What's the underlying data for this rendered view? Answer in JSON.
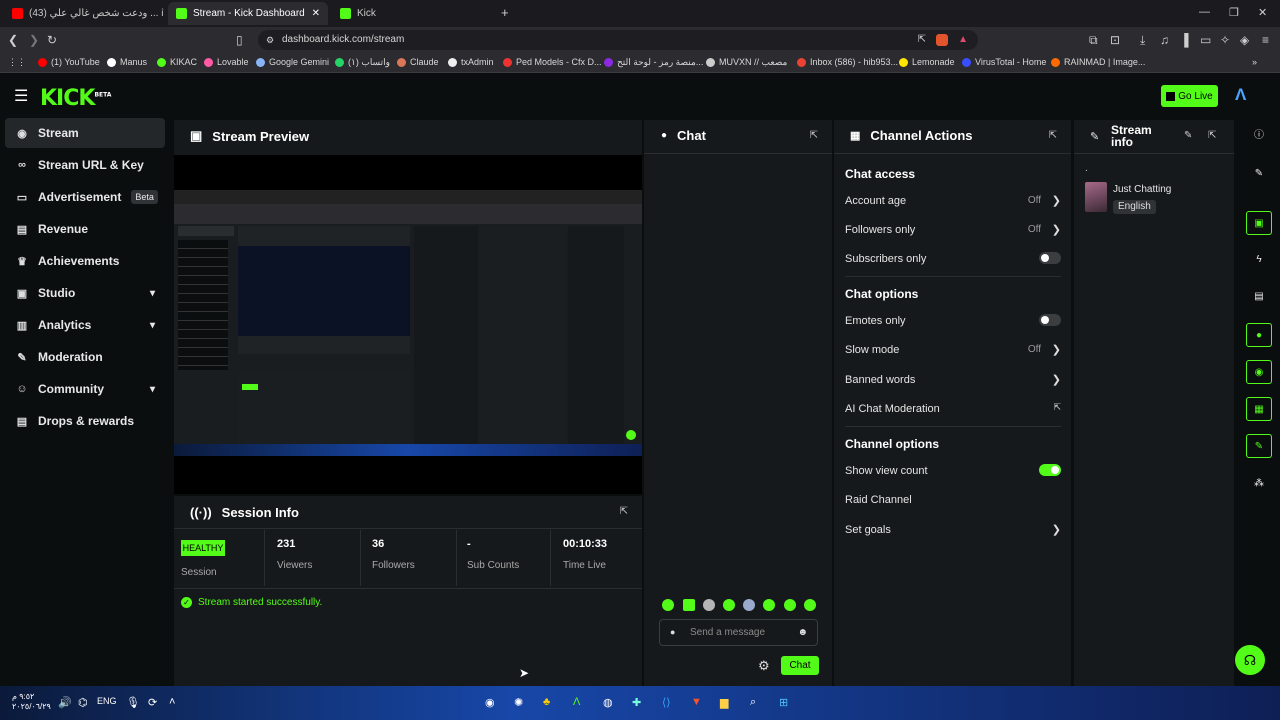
{
  "browser": {
    "tabs": [
      {
        "label": "(43) ودعت شخص غالي علي ... iTube",
        "active": false
      },
      {
        "label": "Stream - Kick Dashboard",
        "active": true
      },
      {
        "label": "Kick",
        "active": false
      }
    ],
    "url": "dashboard.kick.com/stream",
    "bookmarks": [
      "(1) YouTube",
      "Manus",
      "KIKAC",
      "Lovable",
      "Google Gemini",
      "واتساب (١)",
      "Claude",
      "txAdmin",
      "Ped Models - Cfx D...",
      "منصة رمز - لوحة التح...",
      "MUVXN // مصعب",
      "Inbox (586) - hib953...",
      "Lemonade",
      "VirusTotal - Home",
      "RAINMAD | Image..."
    ]
  },
  "header": {
    "logo": "KICK",
    "logo_sup": "BETA",
    "go_live": "Go Live"
  },
  "sidebar": {
    "items": [
      {
        "label": "Stream",
        "icon": "stream-icon",
        "glyph": "((·))"
      },
      {
        "label": "Stream URL & Key",
        "icon": "link-icon",
        "glyph": "🔗"
      },
      {
        "label": "Advertisement",
        "icon": "ad-icon",
        "glyph": "▭",
        "badge": "Beta"
      },
      {
        "label": "Revenue",
        "icon": "chart-icon",
        "glyph": "▤"
      },
      {
        "label": "Achievements",
        "icon": "trophy-icon",
        "glyph": "🏆"
      },
      {
        "label": "Studio",
        "icon": "studio-icon",
        "glyph": "▣"
      },
      {
        "label": "Analytics",
        "icon": "analytics-icon",
        "glyph": "▥"
      },
      {
        "label": "Moderation",
        "icon": "wrench-icon",
        "glyph": "🔧"
      },
      {
        "label": "Community",
        "icon": "community-icon",
        "glyph": "☺"
      },
      {
        "label": "Drops & rewards",
        "icon": "gift-icon",
        "glyph": "▤"
      }
    ]
  },
  "preview": {
    "title": "Stream Preview"
  },
  "session": {
    "title": "Session Info",
    "status_badge": "HEALTHY",
    "status_label": "Session",
    "stats": [
      {
        "value": "231",
        "label": "Viewers"
      },
      {
        "value": "36",
        "label": "Followers"
      },
      {
        "value": "-",
        "label": "Sub Counts"
      },
      {
        "value": "00:10:33",
        "label": "Time Live"
      }
    ],
    "message": "Stream started successfully."
  },
  "chat": {
    "title": "Chat",
    "placeholder": "Send a message",
    "send_label": "Chat"
  },
  "channel_actions": {
    "title": "Channel Actions",
    "sections": {
      "chat_access": "Chat access",
      "chat_options": "Chat options",
      "channel_options": "Channel options"
    },
    "rows": {
      "account_age": {
        "label": "Account age",
        "value": "Off"
      },
      "followers_only": {
        "label": "Followers only",
        "value": "Off"
      },
      "subscribers_only": {
        "label": "Subscribers only",
        "on": false
      },
      "emotes_only": {
        "label": "Emotes only",
        "on": false
      },
      "slow_mode": {
        "label": "Slow mode",
        "value": "Off"
      },
      "banned_words": {
        "label": "Banned words"
      },
      "ai_moderation": {
        "label": "AI Chat Moderation"
      },
      "show_view_count": {
        "label": "Show view count",
        "on": true
      },
      "raid_channel": {
        "label": "Raid Channel"
      },
      "set_goals": {
        "label": "Set goals"
      }
    }
  },
  "stream_info": {
    "title": "Stream info",
    "dot": ".",
    "category": "Just Chatting",
    "language": "English"
  },
  "taskbar": {
    "time": "٩:٥٢ م",
    "date": "٢٠٢٥/٠٦/٢٩",
    "lang": "ENG"
  },
  "colors": {
    "accent": "#53fc18",
    "background": "#0b0e0f",
    "panel": "#16191b"
  }
}
